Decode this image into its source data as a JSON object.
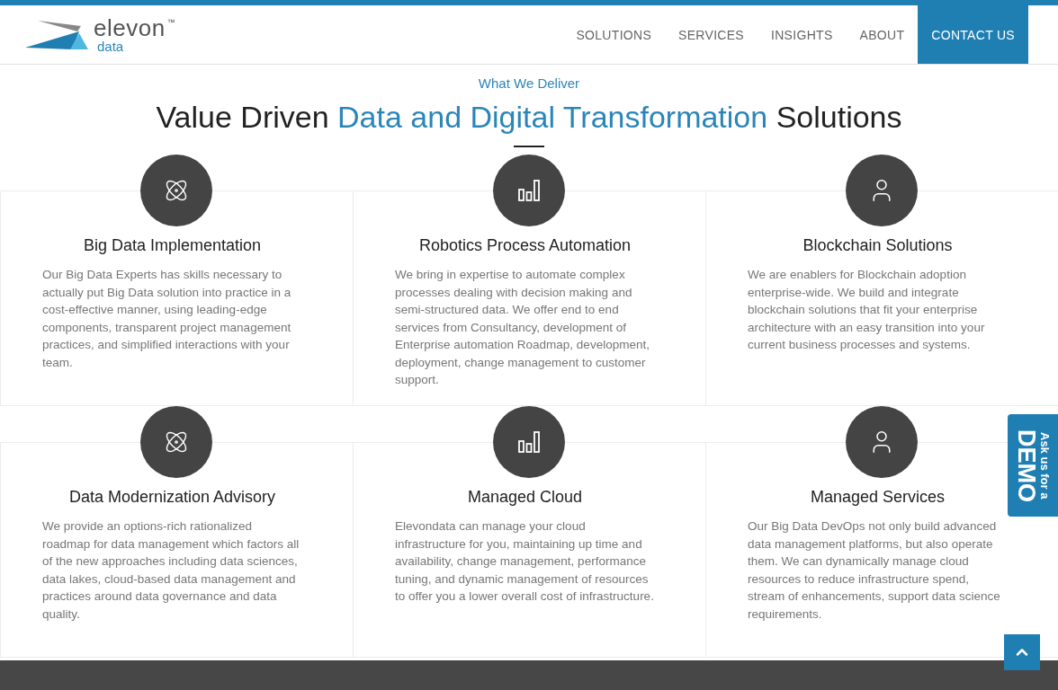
{
  "logo": {
    "name": "elevon",
    "sub": "data",
    "mark": "™"
  },
  "nav": [
    {
      "label": "SOLUTIONS",
      "selected": false
    },
    {
      "label": "SERVICES",
      "selected": false
    },
    {
      "label": "INSIGHTS",
      "selected": false
    },
    {
      "label": "ABOUT",
      "selected": false
    },
    {
      "label": "CONTACT US",
      "selected": true
    }
  ],
  "section": {
    "eyebrow": "What We Deliver",
    "title": [
      {
        "text": "Value Driven",
        "accent": false
      },
      {
        "text": "Data and Digital Transformation",
        "accent": true
      },
      {
        "text": "Solutions",
        "accent": false
      }
    ]
  },
  "cards": [
    {
      "kind": "atom",
      "title": "Big Data Implementation",
      "text": "Our Big Data Experts has skills necessary to actually put Big Data solution into practice in a cost-effective manner, using leading-edge components, transparent project management practices, and simplified interactions with your team."
    },
    {
      "kind": "chart",
      "title": "Robotics Process Automation",
      "text": "We bring in expertise to automate complex processes dealing with decision making and semi-structured data. We offer end to end services from Consultancy, development of Enterprise automation Roadmap, development, deployment, change management to customer support."
    },
    {
      "kind": "person",
      "title": "Blockchain Solutions",
      "text": "We are enablers for Blockchain adoption enterprise-wide. We build and integrate blockchain solutions that fit your enterprise architecture with an easy transition into your current business processes and systems."
    },
    {
      "kind": "atom",
      "title": "Data Modernization Advisory",
      "text": "We provide an options-rich rationalized roadmap for data management which factors all of the new approaches including data sciences, data lakes, cloud-based data management and practices around data governance and data quality."
    },
    {
      "kind": "chart",
      "title": "Managed Cloud",
      "text": "Elevondata can manage your cloud infrastructure for you, maintaining up time and availability, change management, performance tuning, and dynamic management of resources to offer you a lower overall cost of infrastructure."
    },
    {
      "kind": "person",
      "title": "Managed Services",
      "text": "Our Big Data DevOps not only build advanced data management platforms, but also operate them. We can dynamically manage cloud resources to reduce infrastructure spend, stream of enhancements, support data science requirements."
    }
  ],
  "demo_tab": {
    "small": "Ask us for a",
    "big": "DEMO"
  }
}
